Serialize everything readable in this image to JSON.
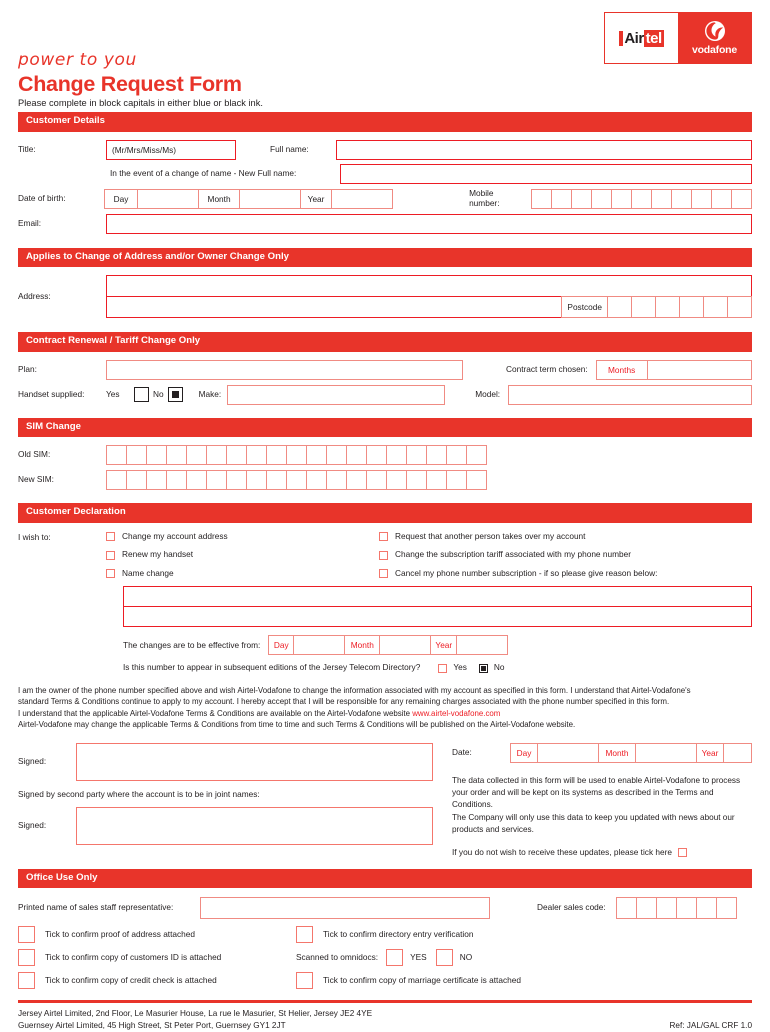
{
  "brand": {
    "accent": "#e8342a",
    "field_border": "#f08b83",
    "airtel_word_1": "Air",
    "airtel_word_2": "tel",
    "vodafone_word": "vodafone",
    "tagline": "power to you"
  },
  "header": {
    "title": "Change Request Form",
    "subtitle": "Please complete in block capitals in either blue or black ink."
  },
  "sections": {
    "customer_details": "Customer Details",
    "address_change": "Applies to Change of Address and/or Owner Change Only",
    "contract_renewal": "Contract Renewal / Tariff Change Only",
    "sim_change": "SIM Change",
    "customer_declaration": "Customer Declaration",
    "office_use": "Office Use Only"
  },
  "customer_details": {
    "title_label": "Title:",
    "title_value": "(Mr/Mrs/Miss/Ms)",
    "full_name_label": "Full name:",
    "full_name_value": "",
    "new_full_name_label": "In the event of a change of name - New Full name:",
    "new_full_name_value": "",
    "dob_label": "Date of birth:",
    "day_label": "Day",
    "month_label": "Month",
    "year_label": "Year",
    "dob_day": "",
    "dob_month": "",
    "dob_year": "",
    "mobile_label": "Mobile number:",
    "mobile_boxes": 11,
    "email_label": "Email:",
    "email_value": ""
  },
  "address_change": {
    "address_label": "Address:",
    "address_line1": "",
    "address_line2": "",
    "postcode_label": "Postcode",
    "postcode_boxes": 6
  },
  "contract_renewal": {
    "plan_label": "Plan:",
    "plan_value": "",
    "contract_term_label": "Contract term chosen:",
    "months_label": "Months",
    "months_value": "",
    "handset_label": "Handset supplied:",
    "yes_label": "Yes",
    "no_label": "No",
    "handset_yes_checked": false,
    "handset_no_checked": true,
    "make_label": "Make:",
    "make_value": "",
    "model_label": "Model:",
    "model_value": ""
  },
  "sim_change": {
    "old_sim_label": "Old SIM:",
    "new_sim_label": "New SIM:",
    "sim_boxes": 19
  },
  "customer_declaration": {
    "i_wish_to_label": "I wish to:",
    "options_left": [
      {
        "label": "Change my account address",
        "checked": false
      },
      {
        "label": "Renew my handset",
        "checked": false
      },
      {
        "label": "Name change",
        "checked": false
      }
    ],
    "options_right": [
      {
        "label": "Request that another person takes over my account",
        "checked": false
      },
      {
        "label": "Change the subscription tariff associated with my phone number",
        "checked": false
      },
      {
        "label": "Cancel my phone number subscription - if so please give reason below:",
        "checked": false
      }
    ],
    "reason_line1": "",
    "reason_line2": "",
    "effective_label": "The changes are to be effective from:",
    "day_label": "Day",
    "month_label": "Month",
    "year_label": "Year",
    "effective_day": "",
    "effective_month": "",
    "effective_year": "",
    "directory_question": "Is this number to appear in subsequent editions of the Jersey Telecom Directory?",
    "directory_yes_label": "Yes",
    "directory_no_label": "No",
    "directory_yes_checked": false,
    "directory_no_checked": true,
    "paragraph_1": "I am the owner of the phone number specified above and wish Airtel-Vodafone to change the information associated with my account as specified in this form. I understand that  Airtel-Vodafone's",
    "paragraph_2": "standard Terms & Conditions continue to apply to my account. I hereby accept that I will be responsible for any remaining charges associated with the phone number specified in this form.",
    "paragraph_3_pre": "I understand that the applicable Airtel-Vodafone Terms & Conditions are available on the Airtel-Vodafone website ",
    "paragraph_3_link": "www.airtel-vodafone.com",
    "paragraph_4": "Airtel-Vodafone may change the applicable Terms & Conditions from time to time and such Terms & Conditions will be published on the Airtel-Vodafone website."
  },
  "signature": {
    "signed_label": "Signed:",
    "signed_value": "",
    "second_party_note": "Signed by second party where the account is to be in joint names:",
    "signed2_label": "Signed:",
    "signed2_value": "",
    "date_label": "Date:",
    "day_label": "Day",
    "month_label": "Month",
    "year_label": "Year",
    "date_day": "",
    "date_month": "",
    "date_year": "",
    "privacy_line1": "The data collected in this form will be used to enable Airtel-Vodafone to process",
    "privacy_line2": "your order and will be kept on its systems as described in the Terms and Conditions.",
    "privacy_line3": "The Company will only use this data to keep you updated with news about our",
    "privacy_line4": "products and services.",
    "opt_out_label": "If you do not wish to receive these updates, please tick here",
    "opt_out_checked": false
  },
  "office_use": {
    "printed_name_label": "Printed name of sales staff representative:",
    "printed_name_value": "",
    "dealer_code_label": "Dealer sales code:",
    "dealer_code_boxes": 6,
    "checks_left": [
      {
        "label": "Tick to confirm proof of address attached",
        "checked": false
      },
      {
        "label": "Tick to confirm copy of customers ID is attached",
        "checked": false
      },
      {
        "label": "Tick to confirm copy of credit check is attached",
        "checked": false
      }
    ],
    "check_right_1": {
      "label": "Tick to confirm directory entry verification",
      "checked": false
    },
    "scanned_label": "Scanned to omnidocs:",
    "scanned_yes_label": "YES",
    "scanned_no_label": "NO",
    "scanned_yes_checked": false,
    "scanned_no_checked": false,
    "check_right_3": {
      "label": "Tick to confirm copy of marriage certificate is attached",
      "checked": false
    }
  },
  "footer": {
    "line1": "Jersey Airtel Limited, 2nd Floor, Le Masurier House, La rue le Masurier, St Helier, Jersey JE2 4YE",
    "line2": "Guernsey Airtel Limited, 45 High Street, St Peter Port, Guernsey GY1 2JT",
    "ref": "Ref: JAL/GAL CRF 1.0"
  }
}
